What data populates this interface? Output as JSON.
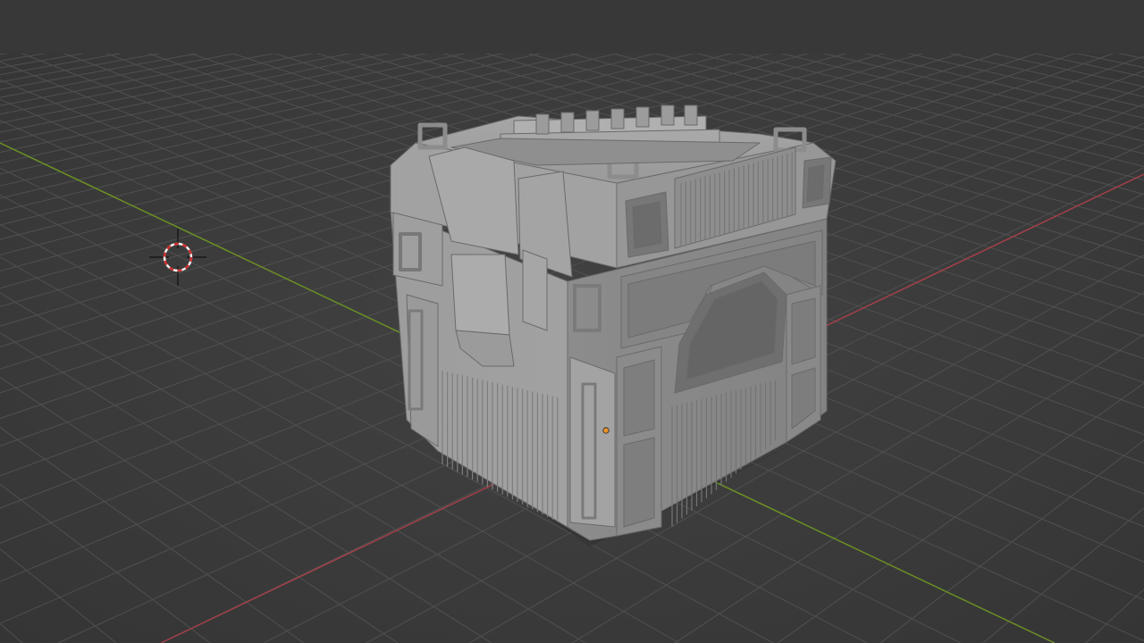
{
  "viewport": {
    "view": "3D Viewport",
    "shading": "solid",
    "colors": {
      "background": "#3d3d3d",
      "grid_line": "#4e4e4e",
      "x_axis": "#a3404a",
      "y_axis": "#6b8f24",
      "mesh_light": "#a9a9a9",
      "mesh_mid": "#8f8f8f",
      "mesh_dark": "#6e6e6e",
      "origin_point": "#e8922a"
    },
    "scene_objects": [
      {
        "name": "sci-fi-crate",
        "kind": "mesh",
        "selected": false
      },
      {
        "name": "3d-cursor",
        "kind": "cursor"
      }
    ],
    "icons": [
      "3d-cursor-icon",
      "object-origin-icon"
    ]
  }
}
